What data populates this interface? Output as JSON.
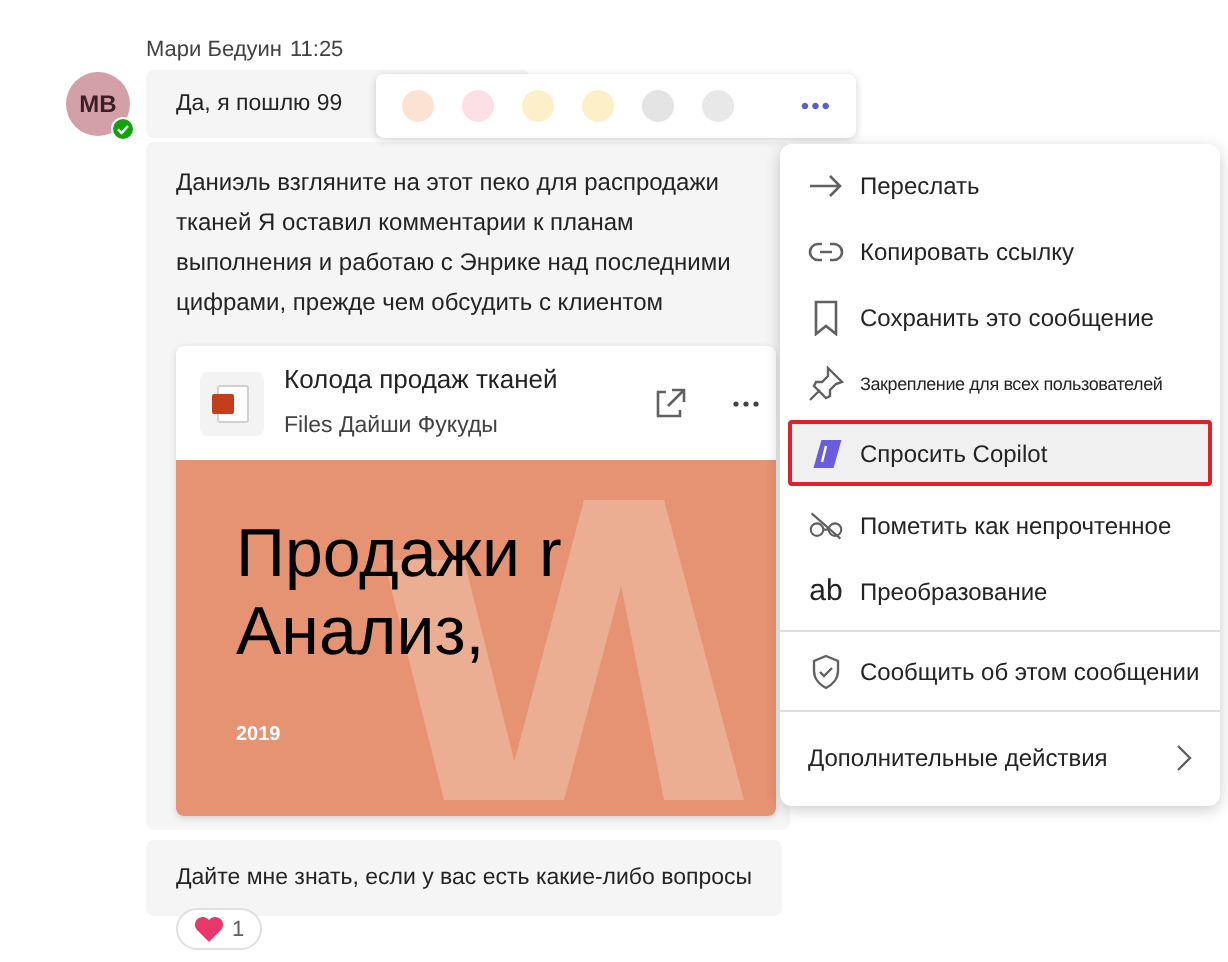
{
  "message": {
    "author": "Мари Бедуин",
    "time": "11:25",
    "avatar_initials": "MB",
    "bubbles": [
      {
        "text": "Да, я пошлю 99"
      },
      {
        "text": "Даниэль взгляните на этот пеко для распродажи тканей Я оставил комментарии к планам выполнения и работаю с Энрике над последними цифрами, прежде чем обсудить с клиентом",
        "attachment": {
          "title": "Колода продаж тканей",
          "subtitle": "Files Дайши Фукуды",
          "slide_title_1": "Продажи r",
          "slide_title_2": "Анализ,",
          "slide_year": "2019"
        }
      },
      {
        "text": "Дайте мне знать, если у вас есть какие-либо вопросы",
        "reactions": [
          {
            "count": "1"
          }
        ]
      }
    ]
  },
  "reaction_bar": {
    "more": "•••"
  },
  "menu": {
    "items": [
      {
        "label": "Переслать",
        "kind": "item",
        "selected": false,
        "divider_before": false
      },
      {
        "label": "Копировать ссылку",
        "kind": "item",
        "selected": false,
        "divider_before": false
      },
      {
        "label": "Сохранить это сообщение",
        "kind": "item",
        "selected": false,
        "divider_before": false
      },
      {
        "label": "Закрепление для всех пользователей",
        "kind": "small",
        "selected": false,
        "divider_before": false
      },
      {
        "label": "Спросить Copilot",
        "kind": "item",
        "selected": true,
        "divider_before": false
      },
      {
        "label": "Пометить как непрочтенное",
        "kind": "item",
        "selected": false,
        "divider_before": false
      },
      {
        "label": "Преобразование",
        "kind": "item",
        "selected": false,
        "divider_before": false,
        "icon_text": "ab"
      },
      {
        "label": "Сообщить об этом сообщении",
        "kind": "item",
        "selected": false,
        "divider_before": true
      },
      {
        "label": "Дополнительные действия",
        "kind": "submenu",
        "selected": false,
        "divider_before": true
      }
    ]
  }
}
